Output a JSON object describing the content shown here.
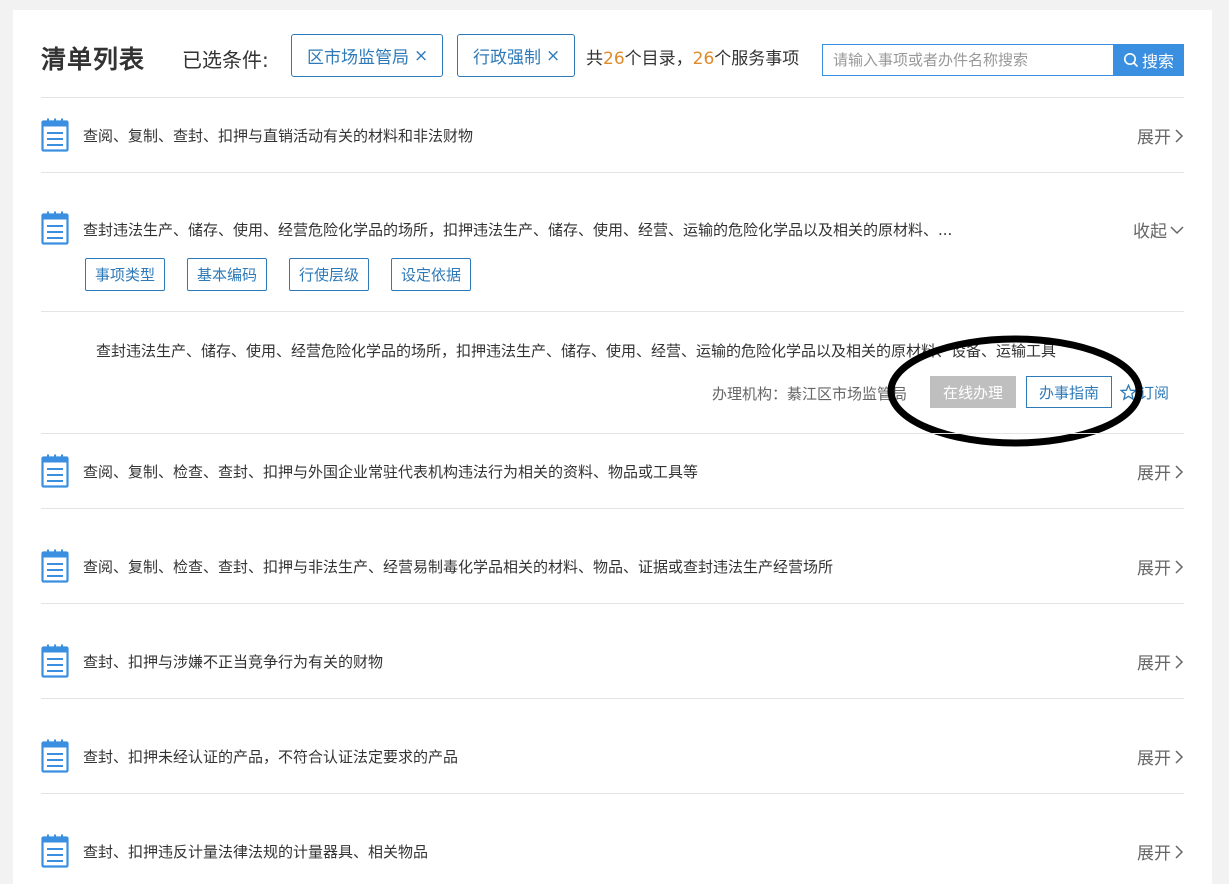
{
  "header": {
    "title": "清单列表",
    "filter_label": "已选条件:",
    "chips": [
      {
        "label": "区市场监管局",
        "close": "×"
      },
      {
        "label": "行政强制",
        "close": "×"
      }
    ],
    "summary": {
      "prefix": "共",
      "catalog_count": "26",
      "catalog_suffix": "个目录，",
      "service_count": "26",
      "service_suffix": "个服务事项"
    },
    "search": {
      "placeholder": "请输入事项或者办件名称搜索",
      "button_label": "搜索"
    }
  },
  "items": [
    {
      "title": "查阅、复制、查封、扣押与直销活动有关的材料和非法财物",
      "toggle": "展开"
    },
    {
      "title": "查封违法生产、储存、使用、经营危险化学品的场所，扣押违法生产、储存、使用、经营、运输的危险化学品以及相关的原材料、...",
      "toggle": "收起"
    },
    {
      "title": "查阅、复制、检查、查封、扣押与外国企业常驻代表机构违法行为相关的资料、物品或工具等",
      "toggle": "展开"
    },
    {
      "title": "查阅、复制、检查、查封、扣押与非法生产、经营易制毒化学品相关的材料、物品、证据或查封违法生产经营场所",
      "toggle": "展开"
    },
    {
      "title": "查封、扣押与涉嫌不正当竞争行为有关的财物",
      "toggle": "展开"
    },
    {
      "title": "查封、扣押未经认证的产品，不符合认证法定要求的产品",
      "toggle": "展开"
    },
    {
      "title": "查封、扣押违反计量法律法规的计量器具、相关物品",
      "toggle": "展开"
    }
  ],
  "expanded": {
    "tags": [
      "事项类型",
      "基本编码",
      "行使层级",
      "设定依据"
    ],
    "detail_text": "查封违法生产、储存、使用、经营危险化学品的场所，扣押违法生产、储存、使用、经营、运输的危险化学品以及相关的原材料、设备、运输工具",
    "org_label": "办理机构：綦江区市场监管局",
    "online_button": "在线办理",
    "guide_button": "办事指南",
    "subscribe_label": "订阅"
  },
  "colors": {
    "accent_blue": "#3b8fe0",
    "link_blue": "#2e7ab8",
    "count_orange": "#e08b2a",
    "disabled_gray": "#bfbfbf"
  }
}
